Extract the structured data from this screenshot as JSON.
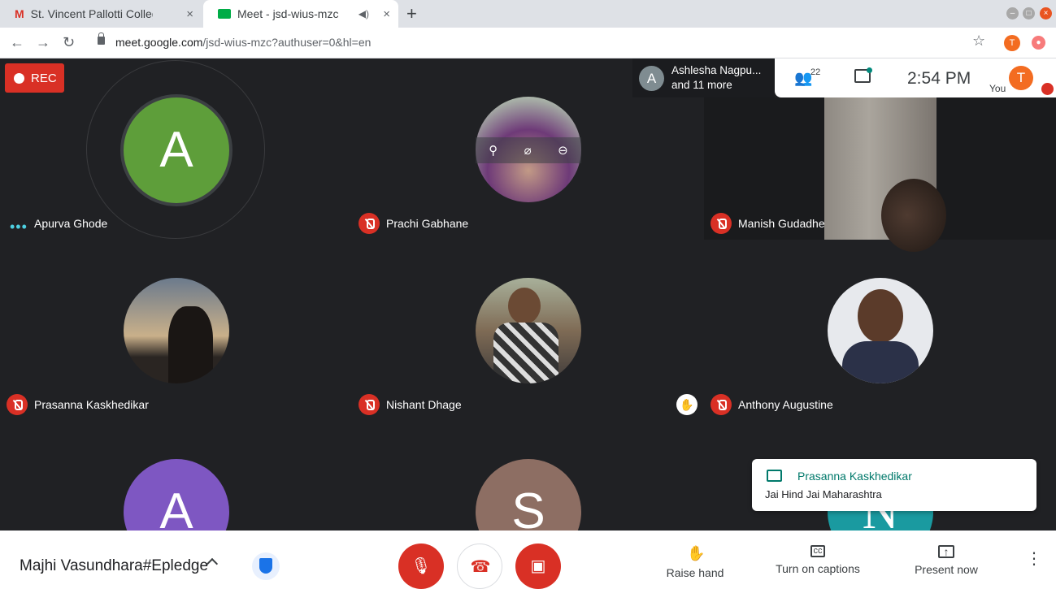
{
  "browser": {
    "tabs": [
      {
        "title": "St. Vincent Pallotti Colleg",
        "close": "×"
      },
      {
        "title": "Meet - jsd-wius-mzc",
        "close": "×"
      }
    ],
    "new_tab": "+",
    "url_domain": "meet.google.com",
    "url_path": "/jsd-wius-mzc?authuser=0&hl=en",
    "profile_initial": "T"
  },
  "meeting": {
    "rec_label": "REC",
    "presenter_info": {
      "avatar": "A",
      "line1": "Ashlesha Nagpu...",
      "line2": "and 11 more"
    },
    "people_count": "22",
    "time": "2:54  PM",
    "self": {
      "initial": "T",
      "label": "You"
    },
    "participants": [
      {
        "name": "Apurva Ghode",
        "initial": "A",
        "color": "#5e9e3a",
        "mic": "speaking"
      },
      {
        "name": "Prachi Gabhane",
        "mic": "muted"
      },
      {
        "name": "Manish Gudadhe",
        "mic": "muted"
      },
      {
        "name": "Prasanna Kaskhedikar",
        "mic": "muted"
      },
      {
        "name": "Nishant Dhage",
        "mic": "muted"
      },
      {
        "name": "Anthony Augustine",
        "mic": "muted",
        "hand_raised": true
      },
      {
        "initial": "A",
        "color": "#7e57c2"
      },
      {
        "initial": "S",
        "color": "#8d6e63"
      },
      {
        "initial": "N",
        "color": "#1a9aa0"
      }
    ],
    "chat_toast": {
      "sender": "Prasanna Kaskhedikar",
      "message": "Jai Hind Jai Maharashtra"
    }
  },
  "bottom_bar": {
    "meeting_name": "Majhi Vasundhara#Epledge",
    "raise_hand": "Raise hand",
    "captions": "Turn on captions",
    "present": "Present now"
  }
}
